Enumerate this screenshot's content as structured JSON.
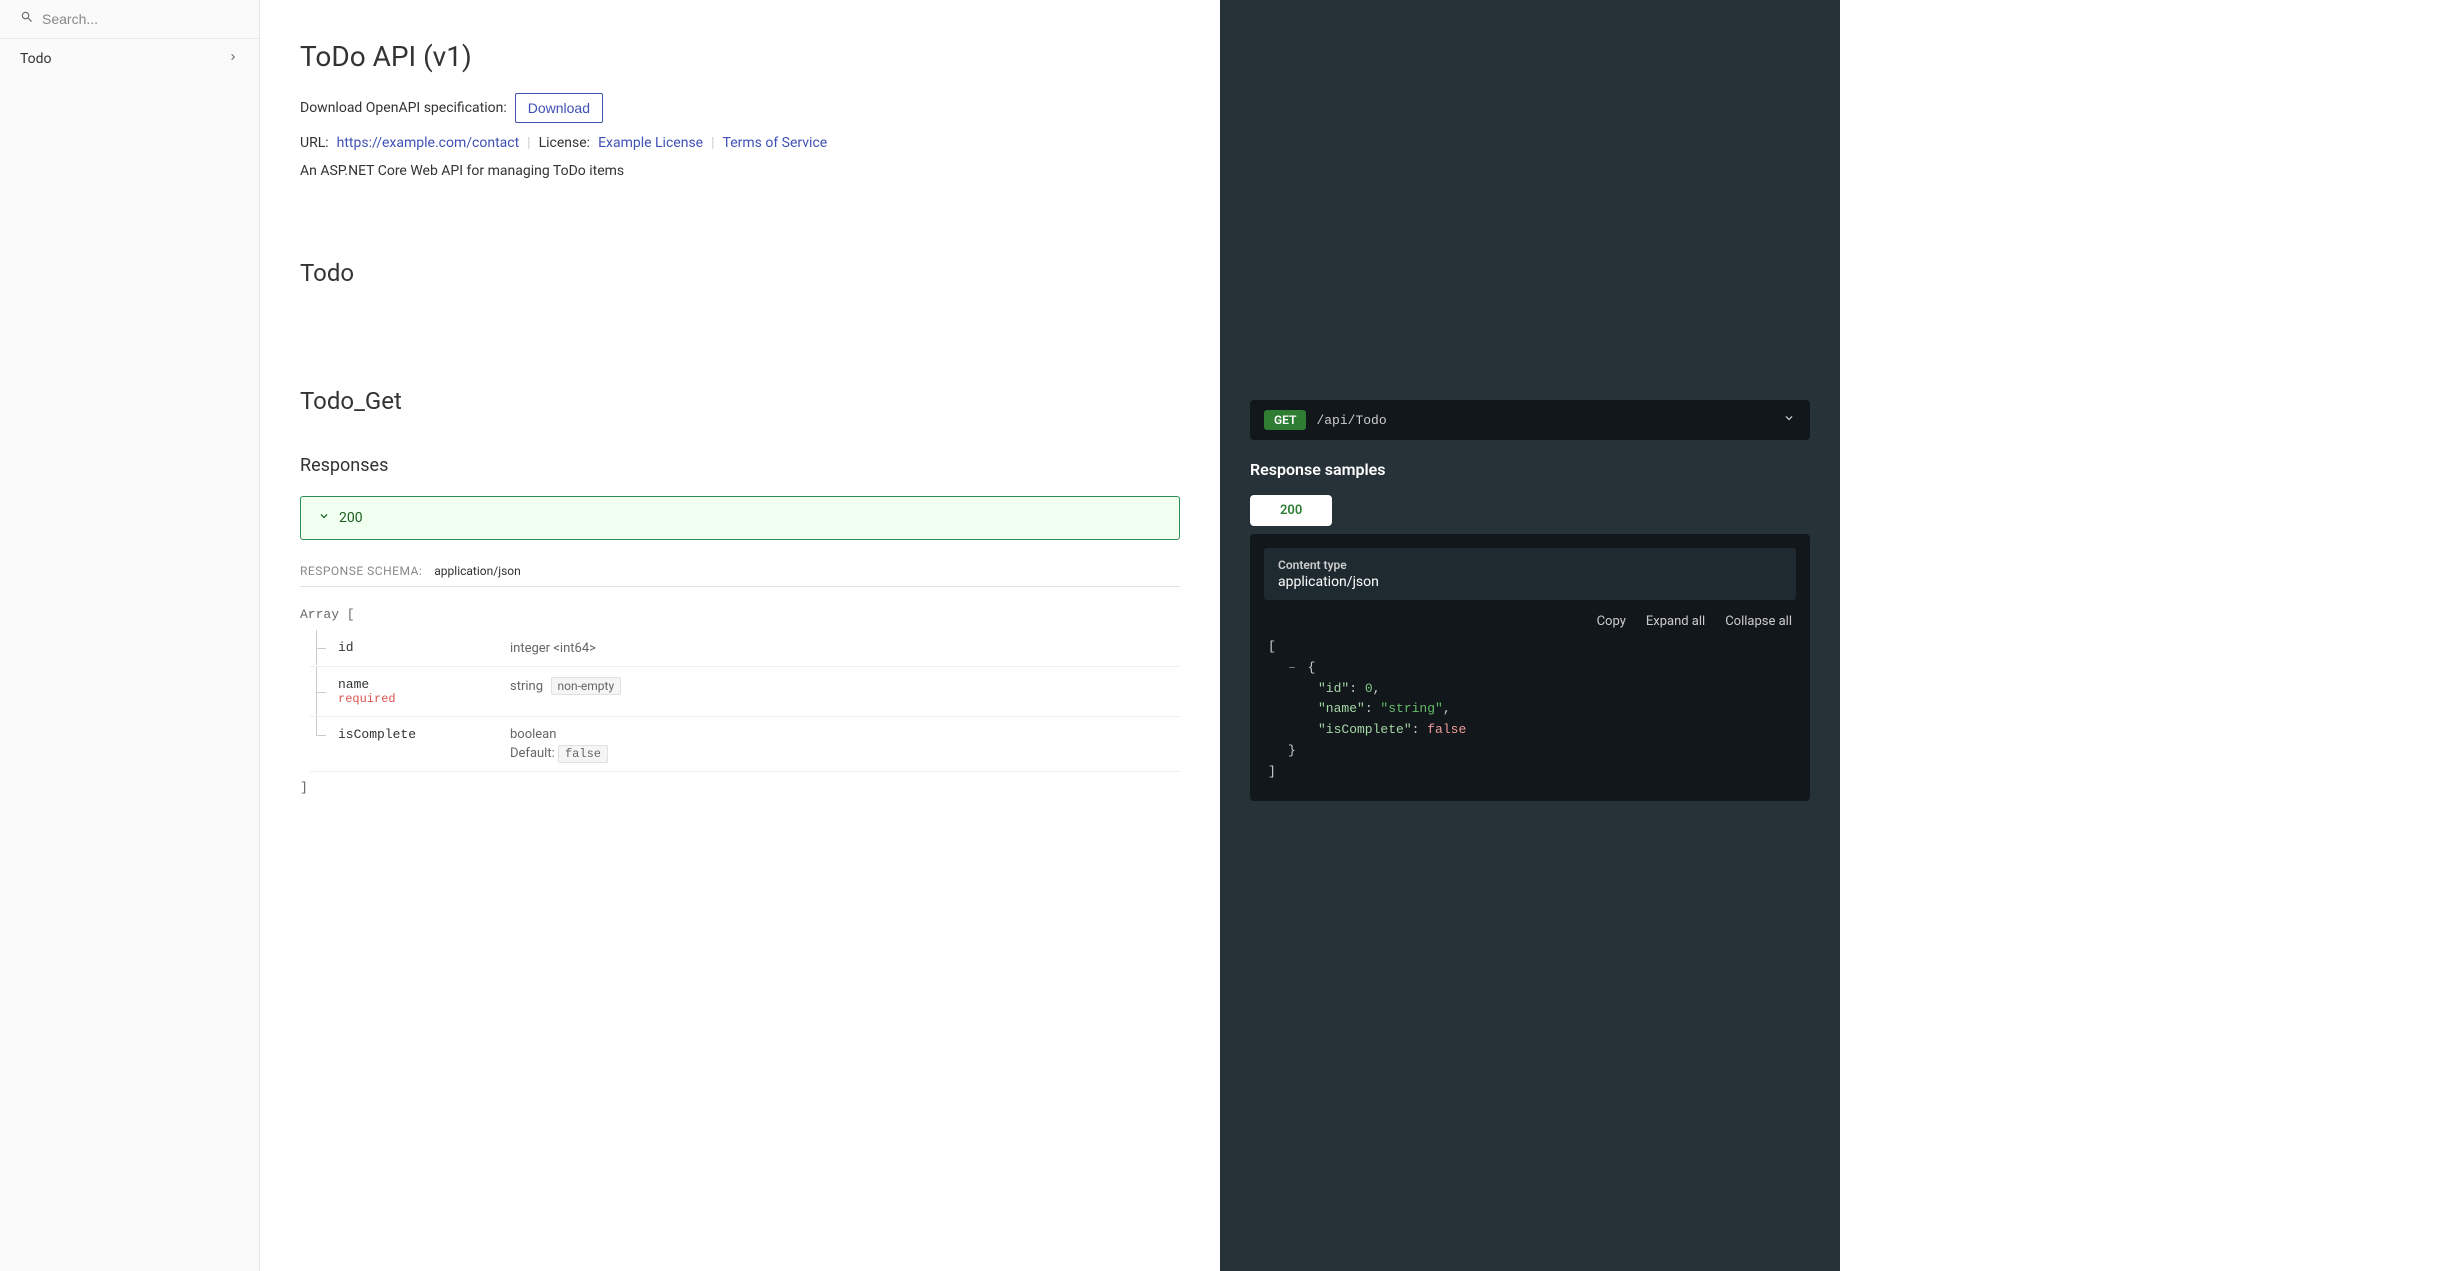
{
  "sidebar": {
    "search_placeholder": "Search...",
    "items": [
      {
        "label": "Todo"
      }
    ]
  },
  "header": {
    "title": "ToDo API (v1)",
    "download_label": "Download OpenAPI specification:",
    "download_button": "Download",
    "url_label": "URL:",
    "url_value": "https://example.com/contact",
    "license_label": "License:",
    "license_value": "Example License",
    "tos_label": "Terms of Service",
    "description": "An ASP.NET Core Web API for managing ToDo items"
  },
  "section": {
    "title": "Todo"
  },
  "operation": {
    "title": "Todo_Get",
    "responses_heading": "Responses",
    "response_code": "200",
    "schema_label": "RESPONSE SCHEMA:",
    "schema_type": "application/json",
    "array_open": "Array [",
    "array_close": "]",
    "properties": [
      {
        "name": "id",
        "type": "integer <int64>",
        "required": false
      },
      {
        "name": "name",
        "type": "string",
        "badge": "non-empty",
        "required": true
      },
      {
        "name": "isComplete",
        "type": "boolean",
        "default_label": "Default:",
        "default": "false",
        "required": false
      }
    ]
  },
  "right": {
    "method": "GET",
    "path": "/api/Todo",
    "samples_title": "Response samples",
    "tab_label": "200",
    "content_type_label": "Content type",
    "content_type_value": "application/json",
    "actions": {
      "copy": "Copy",
      "expand": "Expand all",
      "collapse": "Collapse all"
    },
    "json": {
      "open_bracket": "[",
      "open_brace": "{",
      "id_key": "\"id\"",
      "id_val": "0",
      "name_key": "\"name\"",
      "name_val": "\"string\"",
      "iscomplete_key": "\"isComplete\"",
      "iscomplete_val": "false",
      "close_brace": "}",
      "close_bracket": "]",
      "colon": ": ",
      "comma": ",",
      "toggle": "–"
    }
  },
  "required_text": "required"
}
